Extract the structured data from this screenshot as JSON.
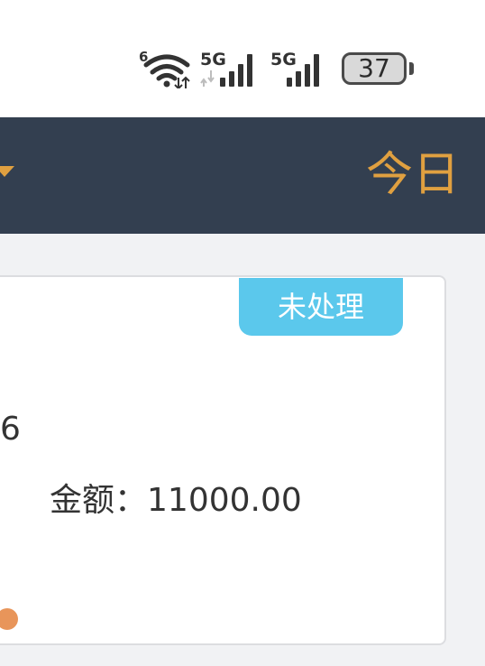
{
  "status_bar": {
    "wifi_icon": "wifi-6-icon",
    "wifi_badge": "6",
    "signal_1_label": "5G",
    "signal_2_label": "5G",
    "battery_level": "37"
  },
  "header": {
    "today_label": "今日",
    "dropdown_icon": "dropdown-arrow-icon",
    "accent_color": "#e0a040",
    "background_color": "#333f50"
  },
  "card": {
    "status_badge": "未处理",
    "status_badge_color": "#5bc8ec",
    "partial_value": "6",
    "amount_label": "金额：",
    "amount_value": "11000.00",
    "dot_color": "#e8955a"
  }
}
